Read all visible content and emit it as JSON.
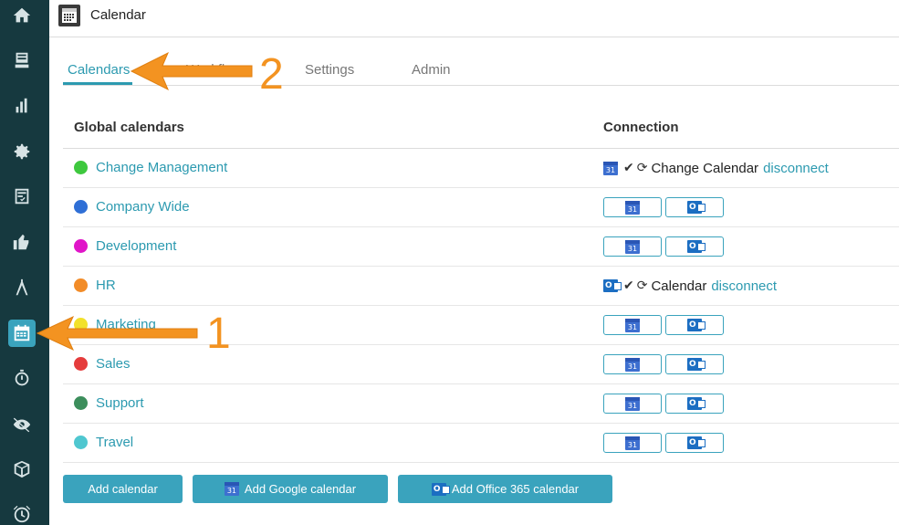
{
  "header": {
    "title": "Calendar",
    "icon": "calendar-icon"
  },
  "sidebar": {
    "items": [
      {
        "name": "home",
        "icon": "home-icon"
      },
      {
        "name": "inbox",
        "icon": "inbox-icon"
      },
      {
        "name": "reports",
        "icon": "bar-chart-icon"
      },
      {
        "name": "settings",
        "icon": "gear-icon"
      },
      {
        "name": "tasks",
        "icon": "checklist-icon"
      },
      {
        "name": "feedback",
        "icon": "thumbs-up-icon"
      },
      {
        "name": "tools",
        "icon": "compass-icon"
      },
      {
        "name": "calendar",
        "icon": "calendar-icon",
        "active": true
      },
      {
        "name": "timer",
        "icon": "stopwatch-icon"
      },
      {
        "name": "privacy",
        "icon": "eye-off-icon"
      },
      {
        "name": "packages",
        "icon": "box-icon"
      },
      {
        "name": "alarms",
        "icon": "alarm-icon"
      }
    ]
  },
  "tabs": [
    {
      "label": "Calendars",
      "active": true
    },
    {
      "label": "Workflows"
    },
    {
      "label": "Settings"
    },
    {
      "label": "Admin"
    }
  ],
  "table": {
    "col_name": "Global calendars",
    "col_connection": "Connection",
    "rows": [
      {
        "name": "Change Management",
        "color": "#3ec83e",
        "connected": "google",
        "conn_label": "Change Calendar",
        "disconnect": "disconnect"
      },
      {
        "name": "Company Wide",
        "color": "#2f6fd6"
      },
      {
        "name": "Development",
        "color": "#e015c8"
      },
      {
        "name": "HR",
        "color": "#f28c28",
        "connected": "office365",
        "conn_label": "Calendar",
        "disconnect": "disconnect"
      },
      {
        "name": "Marketing",
        "color": "#f2e12a"
      },
      {
        "name": "Sales",
        "color": "#e53c3c"
      },
      {
        "name": "Support",
        "color": "#3c8e5c"
      },
      {
        "name": "Travel",
        "color": "#4fc7d0"
      }
    ]
  },
  "icons": {
    "google_calendar_day": "31",
    "office_letter": "O"
  },
  "buttons": {
    "add_calendar": "Add calendar",
    "add_google": "Add Google calendar",
    "add_office": "Add Office 365 calendar"
  },
  "annotations": {
    "arrow1_number": "1",
    "arrow2_number": "2",
    "color": "#f39321"
  },
  "colors": {
    "accent": "#3aa3bd",
    "sidebar": "#16393f",
    "link": "#2c9ab0"
  }
}
